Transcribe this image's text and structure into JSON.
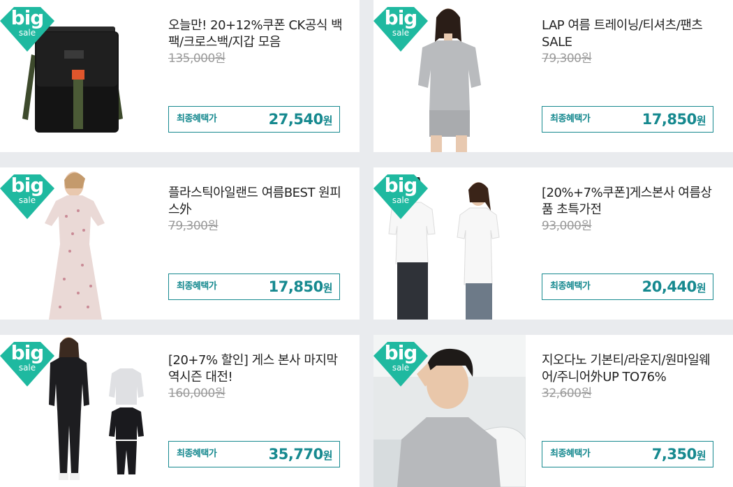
{
  "badge": {
    "big": "big",
    "sale": "sale",
    "color": "#1fb9a0"
  },
  "final_label": "최종혜택가",
  "accent_color": "#16898f",
  "products": [
    {
      "title": "오늘만! 20+12%쿠폰 CK공식 백팩/크로스백/지갑 모음",
      "original_price": "135,000원",
      "final_price": "27,540",
      "currency": "원",
      "image_icon": "crossbody-bag-image"
    },
    {
      "title": "LAP 여름 트레이닝/티셔츠/팬츠 SALE",
      "original_price": "79,300원",
      "final_price": "17,850",
      "currency": "원",
      "image_icon": "model-gray-tracksuit-image"
    },
    {
      "title": "플라스틱아일랜드 여름BEST 원피스外",
      "original_price": "79,300원",
      "final_price": "17,850",
      "currency": "원",
      "image_icon": "model-floral-dress-image"
    },
    {
      "title": "[20%+7%쿠폰]게스본사 여름상품 초특가전",
      "original_price": "93,000원",
      "final_price": "20,440",
      "currency": "원",
      "image_icon": "couple-white-tees-image"
    },
    {
      "title": "[20+7% 할인] 게스 본사 마지막 역시즌 대전!",
      "original_price": "160,000원",
      "final_price": "35,770",
      "currency": "원",
      "image_icon": "black-tracksuit-image"
    },
    {
      "title": "지오다노 기본티/라운지/원마일웨어/주니어外UP TO76%",
      "original_price": "32,600원",
      "final_price": "7,350",
      "currency": "원",
      "image_icon": "model-gray-tee-image"
    }
  ]
}
